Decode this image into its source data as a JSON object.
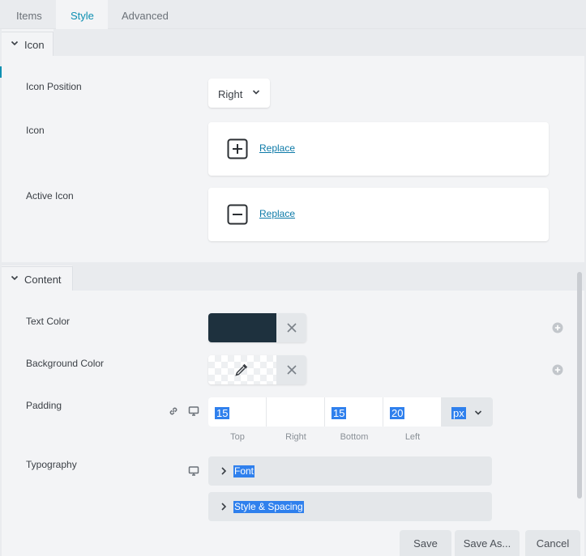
{
  "tabs": [
    {
      "label": "Items"
    },
    {
      "label": "Style"
    },
    {
      "label": "Advanced"
    }
  ],
  "icon_section": {
    "title": "Icon",
    "icon_position": {
      "label": "Icon Position",
      "value": "Right"
    },
    "icon": {
      "label": "Icon",
      "action": "Replace"
    },
    "active_icon": {
      "label": "Active Icon",
      "action": "Replace"
    }
  },
  "content_section": {
    "title": "Content",
    "text_color": {
      "label": "Text Color",
      "value": "#1e313e"
    },
    "background_color": {
      "label": "Background Color"
    },
    "padding": {
      "label": "Padding",
      "top": "15",
      "right": "",
      "bottom": "15",
      "left": "20",
      "unit": "px",
      "captions": {
        "top": "Top",
        "right": "Right",
        "bottom": "Bottom",
        "left": "Left"
      }
    },
    "typography": {
      "label": "Typography",
      "groups": [
        {
          "label": "Font"
        },
        {
          "label": "Style & Spacing"
        }
      ]
    }
  },
  "footer": {
    "save": "Save",
    "save_as": "Save As...",
    "cancel": "Cancel"
  },
  "colors": {
    "accent": "#0d8fb1",
    "selection": "#2f80ed",
    "link": "#0d7aa8"
  }
}
